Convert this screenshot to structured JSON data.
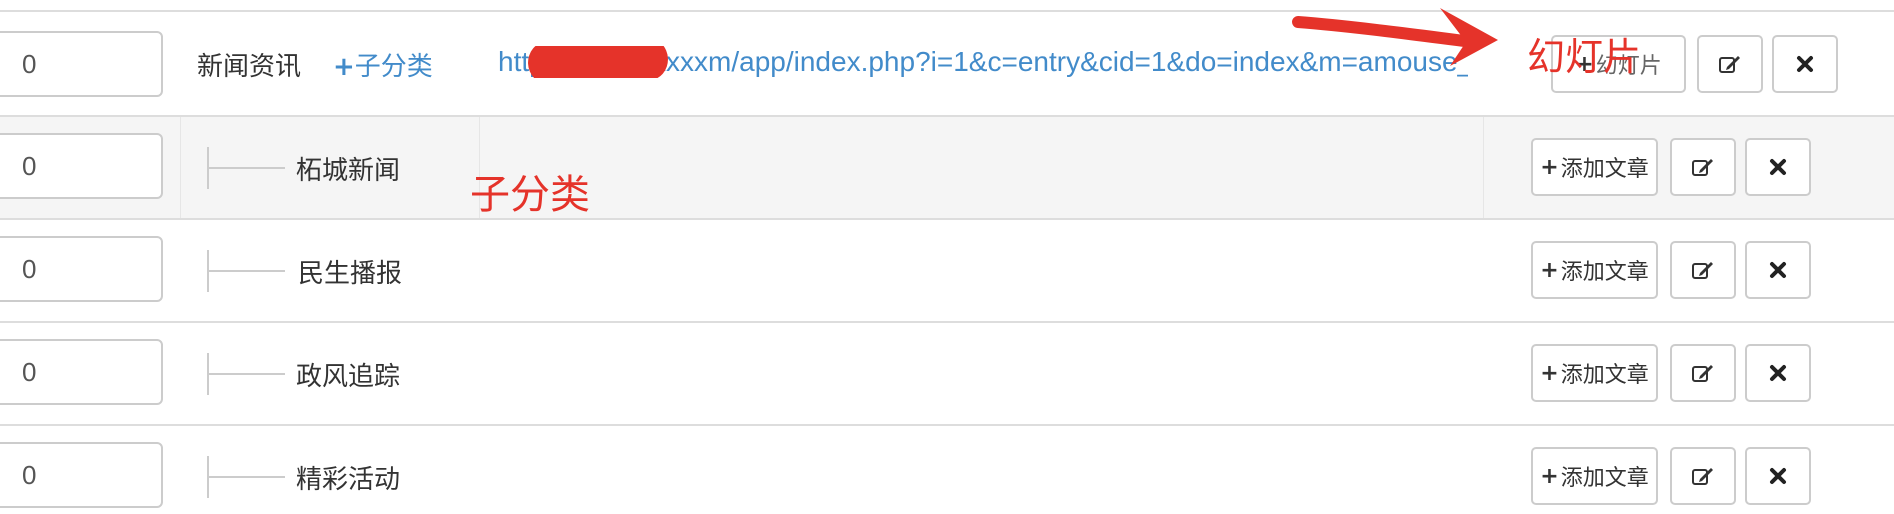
{
  "rows": [
    {
      "order": "0",
      "name": "新闻资讯",
      "sub_link_plus": "+",
      "sub_link_label": "子分类",
      "url": "http://xxxxxxxxxxm/app/index.php?i=1&c=entry&cid=1&do=index&m=amouse_…",
      "action_label": "幻灯片"
    },
    {
      "order": "0",
      "name": "柘城新闻",
      "action_label": "添加文章"
    },
    {
      "order": "0",
      "name": "民生播报",
      "action_label": "添加文章"
    },
    {
      "order": "0",
      "name": "政风追踪",
      "action_label": "添加文章"
    },
    {
      "order": "0",
      "name": "精彩活动",
      "action_label": "添加文章"
    }
  ],
  "plus_glyph": "+",
  "annotations": {
    "slideshow": "幻灯片",
    "subcategory": "子分类",
    "color": "#e5332a"
  },
  "icons": {
    "edit": "edit-icon",
    "remove": "close-icon",
    "plus": "plus-icon",
    "arrow": "red-arrow-annotation"
  },
  "colors": {
    "link": "#428bca",
    "border": "#cccccc",
    "row_hover": "#f5f5f5",
    "annotation": "#e5332a"
  }
}
